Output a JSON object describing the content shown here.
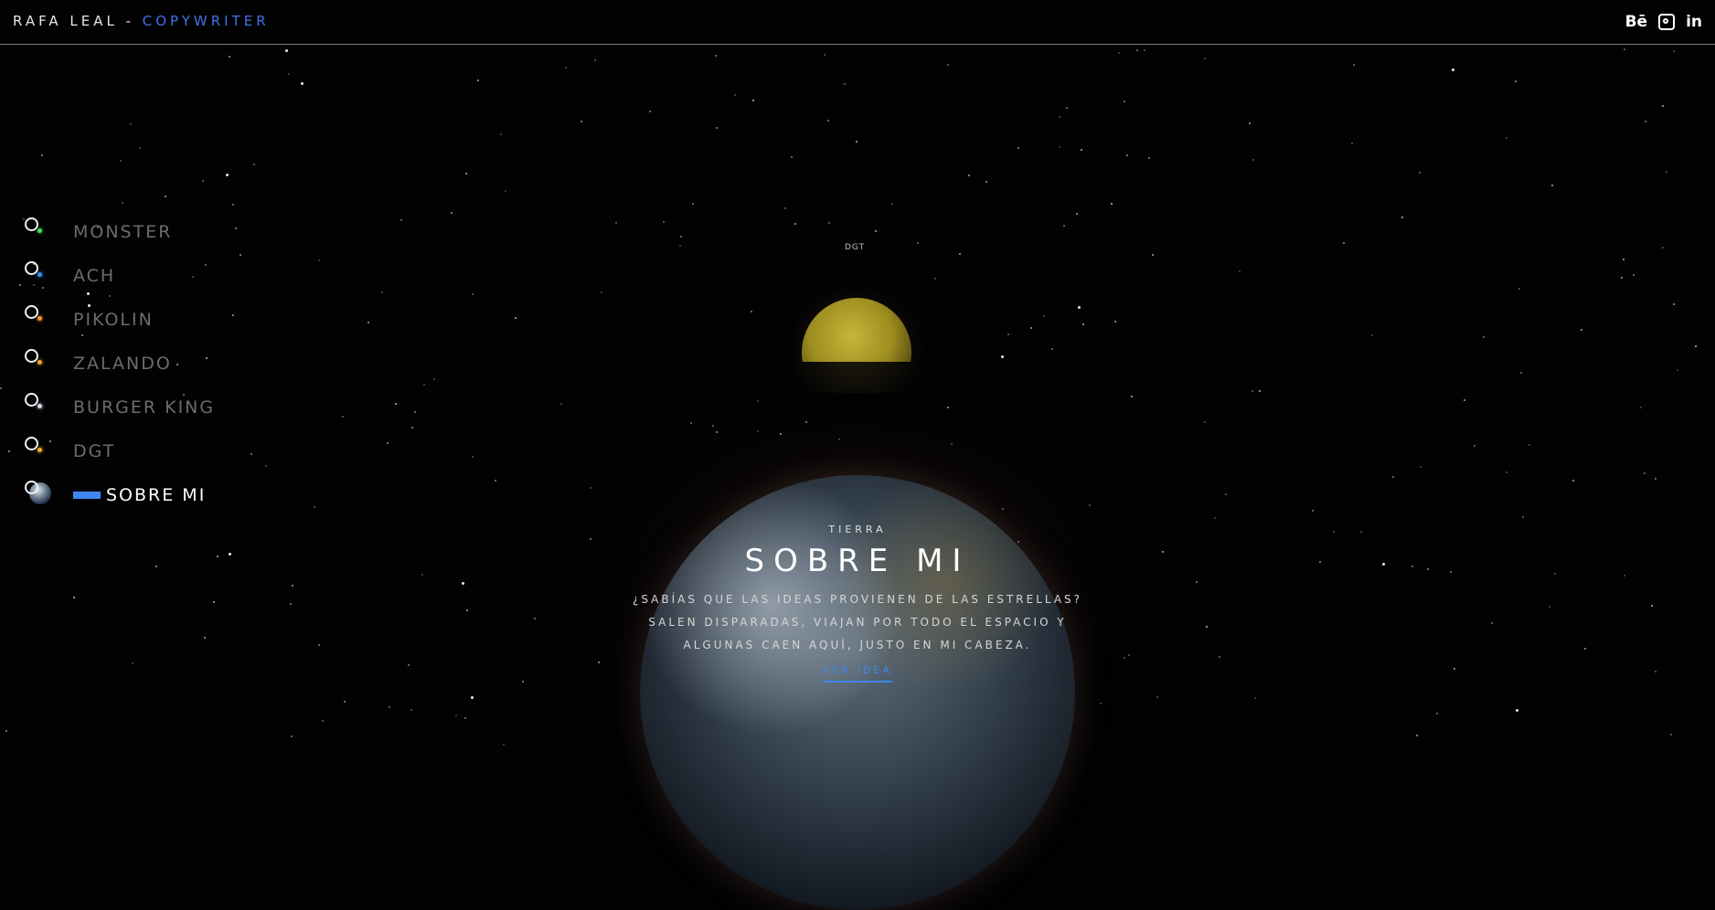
{
  "header": {
    "brand_name": "RAFA LEAL - ",
    "brand_role": "COPYWRITER",
    "social": [
      {
        "icon": "behance-icon",
        "label": "Bē"
      },
      {
        "icon": "instagram-icon"
      },
      {
        "icon": "linkedin-icon",
        "label": "in"
      }
    ]
  },
  "nav": {
    "items": [
      {
        "label": "MONSTER",
        "dot_color": "#3ee05a"
      },
      {
        "label": "ACH",
        "dot_color": "#3a8ef0"
      },
      {
        "label": "PIKOLIN",
        "dot_color": "#f09a2a"
      },
      {
        "label": "ZALANDO",
        "dot_color": "#f0a52a"
      },
      {
        "label": "BURGER KING",
        "dot_color": "#d8d8e8"
      },
      {
        "label": "DGT",
        "dot_color": "#f0b02a"
      },
      {
        "label": "SOBRE MI",
        "active": true
      }
    ]
  },
  "moon": {
    "label": "DGT"
  },
  "hero": {
    "kicker": "TIERRA",
    "title": "SOBRE MI",
    "body": "¿SABÍAS QUE LAS IDEAS PROVIENEN DE LAS ESTRELLAS? SALEN DISPARADAS, VIAJAN POR TODO EL ESPACIO Y ALGUNAS CAEN AQUÍ, JUSTO EN MI CABEZA.",
    "link_label": "VER IDEA"
  },
  "colors": {
    "accent": "#3e86ee",
    "brand_accent": "#3f72e8",
    "background": "#020203"
  }
}
